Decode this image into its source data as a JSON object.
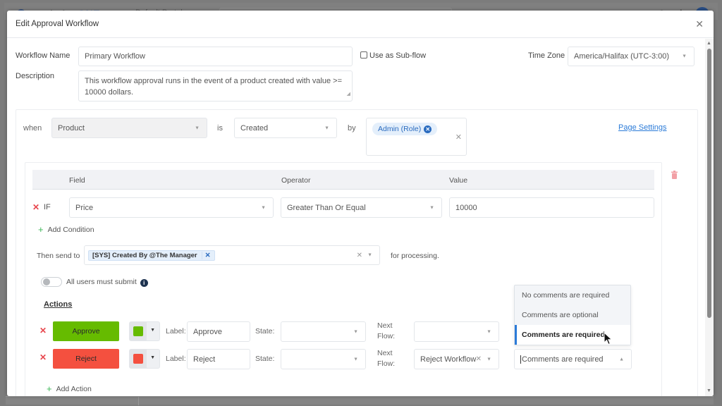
{
  "background_app": {
    "logo_text": "pandadoc",
    "logo_suffix": "ONE",
    "breadcrumb": "Default Portal"
  },
  "modal": {
    "title": "Edit Approval Workflow",
    "close_icon": "close-icon"
  },
  "form": {
    "workflow_name_label": "Workflow Name",
    "workflow_name_value": "Primary Workflow",
    "sub_flow_label": "Use as Sub-flow",
    "sub_flow_checked": false,
    "time_zone_label": "Time Zone",
    "time_zone_value": "America/Halifax (UTC-3:00)",
    "description_label": "Description",
    "description_value": "This workflow approval runs in the event of a product created with value >= 10000 dollars."
  },
  "trigger": {
    "when_label": "when",
    "entity_value": "Product",
    "is_label": "is",
    "event_value": "Created",
    "by_label": "by",
    "by_tags": [
      "Admin (Role)"
    ],
    "page_settings_link": "Page Settings"
  },
  "conditions": {
    "headers": [
      "Field",
      "Operator",
      "Value"
    ],
    "rows": [
      {
        "prefix": "IF",
        "field": "Price",
        "operator": "Greater Than Or Equal",
        "value": "10000"
      }
    ],
    "add_condition_label": "Add Condition"
  },
  "routing": {
    "then_send_to_label": "Then send to",
    "recipients": [
      "[SYS] Created By @The Manager"
    ],
    "suffix_label": "for processing.",
    "all_users_must_submit_label": "All users must submit",
    "all_users_must_submit": false
  },
  "actions": {
    "title": "Actions",
    "label_caption": "Label:",
    "state_caption": "State:",
    "next_flow_caption_1": "Next",
    "next_flow_caption_2": "Flow:",
    "items": [
      {
        "button_label": "Approve",
        "color": "#66bb00",
        "label_value": "Approve",
        "state_value": "",
        "next_flow_value": "",
        "comments_value": ""
      },
      {
        "button_label": "Reject",
        "color": "#f4503f",
        "label_value": "Reject",
        "state_value": "",
        "next_flow_value": "Reject Workflow",
        "comments_value": "Comments are required"
      }
    ],
    "add_action_label": "Add Action"
  },
  "comments_dropdown": {
    "options": [
      "No comments are required",
      "Comments are optional",
      "Comments are required"
    ],
    "selected": "Comments are required"
  },
  "colors": {
    "accent": "#2b7bd8",
    "danger": "#e8474e",
    "success": "#3fb85a"
  }
}
